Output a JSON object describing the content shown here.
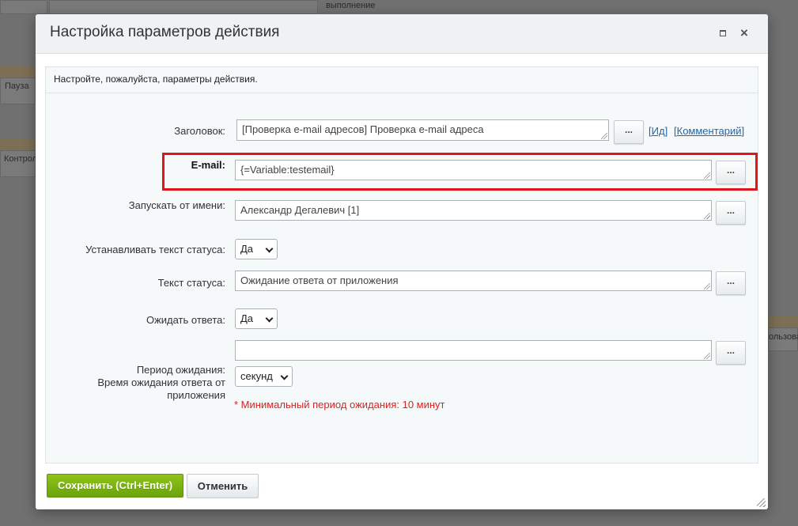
{
  "background": {
    "top_label": "выполнение",
    "left_label_1": "Пауза",
    "left_label_2": "Контрол",
    "right_label": "ользова"
  },
  "dialog": {
    "title": "Настройка параметров действия",
    "hint": "Настройте, пожалуйста, параметры действия.",
    "fields": {
      "title_label": "Заголовок:",
      "title_value": "[Проверка e-mail адресов] Проверка e-mail адреса",
      "id_link": "Ид",
      "comment_link": "Комментарий",
      "email_label": "E-mail:",
      "email_value": "{=Variable:testemail}",
      "run_as_label": "Запускать от имени:",
      "run_as_value": "Александр Дегалевич [1]",
      "set_status_label": "Устанавливать текст статуса:",
      "set_status_value": "Да",
      "status_text_label": "Текст статуса:",
      "status_text_value": "Ожидание ответа от приложения",
      "wait_answer_label": "Ожидать ответа:",
      "wait_answer_value": "Да",
      "period_label_1": "Период ожидания:",
      "period_label_2": "Время ожидания ответа от",
      "period_label_3": "приложения",
      "period_value": "",
      "period_unit": "секунд",
      "min_period_note": "* Минимальный период ожидания: 10 минут"
    },
    "dots_label": "...",
    "save_label": "Сохранить (Ctrl+Enter)",
    "cancel_label": "Отменить"
  },
  "colors": {
    "highlight": "#e0161c",
    "save_button": "#7ab412",
    "link": "#2067b0",
    "note": "#e02020"
  }
}
